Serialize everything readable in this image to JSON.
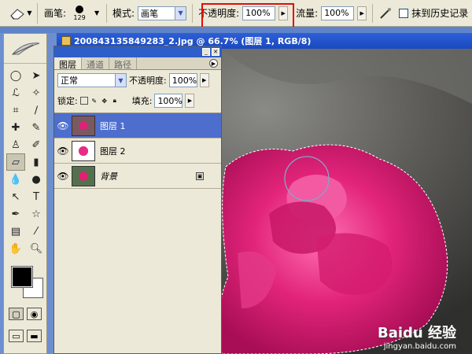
{
  "options_bar": {
    "brush_label": "画笔:",
    "brush_size": "129",
    "mode_label": "模式:",
    "mode_value": "画笔",
    "opacity_label": "不透明度:",
    "opacity_value": "100%",
    "flow_label": "流量:",
    "flow_value": "100%",
    "history_label": "抹到历史记录"
  },
  "document": {
    "title": "200843135849283_2.jpg @ 66.7% (图层 1, RGB/8)"
  },
  "layers_panel": {
    "tabs": [
      "图层",
      "通道",
      "路径"
    ],
    "blend_mode": "正常",
    "opacity_label": "不透明度:",
    "opacity_value": "100%",
    "lock_label": "锁定:",
    "fill_label": "填充:",
    "fill_value": "100%",
    "layers": [
      {
        "name": "图层 1",
        "selected": true
      },
      {
        "name": "图层 2",
        "selected": false
      },
      {
        "name": "背景",
        "selected": false
      }
    ]
  },
  "watermark": {
    "brand": "Baidu 经验",
    "url": "jingyan.baidu.com"
  },
  "colors": {
    "highlight": "#e00d0d",
    "selected_layer": "#4d6ecd",
    "titlebar": "#2d5fd6",
    "rose": "#e0207a"
  }
}
